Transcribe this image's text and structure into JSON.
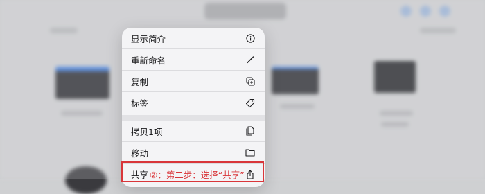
{
  "menu": {
    "items": [
      {
        "label": "显示简介",
        "icon": "info-circle-icon"
      },
      {
        "label": "重新命名",
        "icon": "pencil-icon"
      },
      {
        "label": "复制",
        "icon": "duplicate-icon"
      },
      {
        "label": "标签",
        "icon": "tag-icon"
      },
      {
        "label": "拷贝1项",
        "icon": "copy-doc-icon"
      },
      {
        "label": "移动",
        "icon": "folder-icon"
      },
      {
        "label": "共享",
        "icon": "share-icon"
      }
    ]
  },
  "annotation": {
    "text": "②：第二步：选择“共享”",
    "color": "#d9363a"
  }
}
